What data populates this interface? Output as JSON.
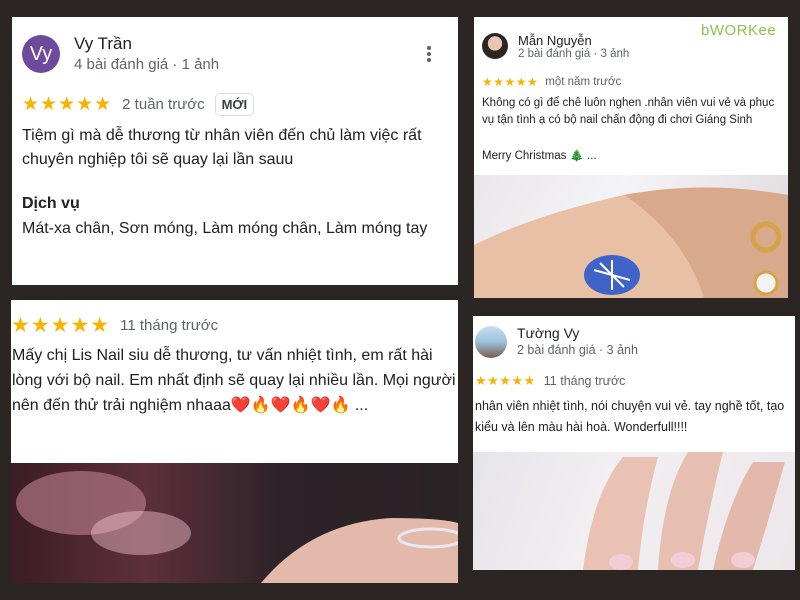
{
  "reviews": [
    {
      "avatar_letter": "Vy",
      "author": "Vy Trần",
      "meta": "4 bài đánh giá · 1 ảnh",
      "stars": "★★★★★",
      "age": "2 tuần trước",
      "badge": "MỚI",
      "text": "Tiệm gì mà dễ thương từ nhân viên đến chủ làm việc rất chuyên nghiệp tôi sẽ quay lại lần sauu",
      "services_title": "Dịch vụ",
      "services": "Mát-xa chân, Sơn móng, Làm móng chân, Làm móng tay"
    },
    {
      "author": "Mẫn Nguyễn",
      "meta": "2 bài đánh giá · 3 ảnh",
      "brand": "bWORKee",
      "stars": "★★★★★",
      "age": "một năm trước",
      "text": "Không có gì để chê luôn nghen .nhân viên vui vẻ và phục vụ tận tình ạ có bộ nail chấn động đi chơi Giáng Sinh",
      "text_2": "Merry Christmas 🎄 ..."
    },
    {
      "stars": "★★★★★",
      "age": "11 tháng trước",
      "text": "Mấy chị Lis Nail siu dễ thương, tư vấn nhiệt tình, em rất hài lòng với bộ nail. Em nhất định sẽ quay lại nhiều lần. Mọi người nên đến thử trải nghiệm nhaaa❤️🔥❤️🔥❤️🔥 ..."
    },
    {
      "author": "Tường Vy",
      "meta": "2 bài đánh giá · 3 ảnh",
      "stars": "★★★★★",
      "age": "11 tháng trước",
      "text": "nhân viên nhiệt tình, nói chuyện vui vẻ. tay nghề tốt, tạo kiểu và lên màu hài hoà. Wonderfull!!!!"
    }
  ],
  "colors": {
    "background": "#2b2523",
    "star": "#f6b300",
    "brand": "#8bc34a",
    "avatar_vy": "#6e4a9e"
  },
  "icons": [
    "more-vert-icon",
    "star-icon"
  ]
}
